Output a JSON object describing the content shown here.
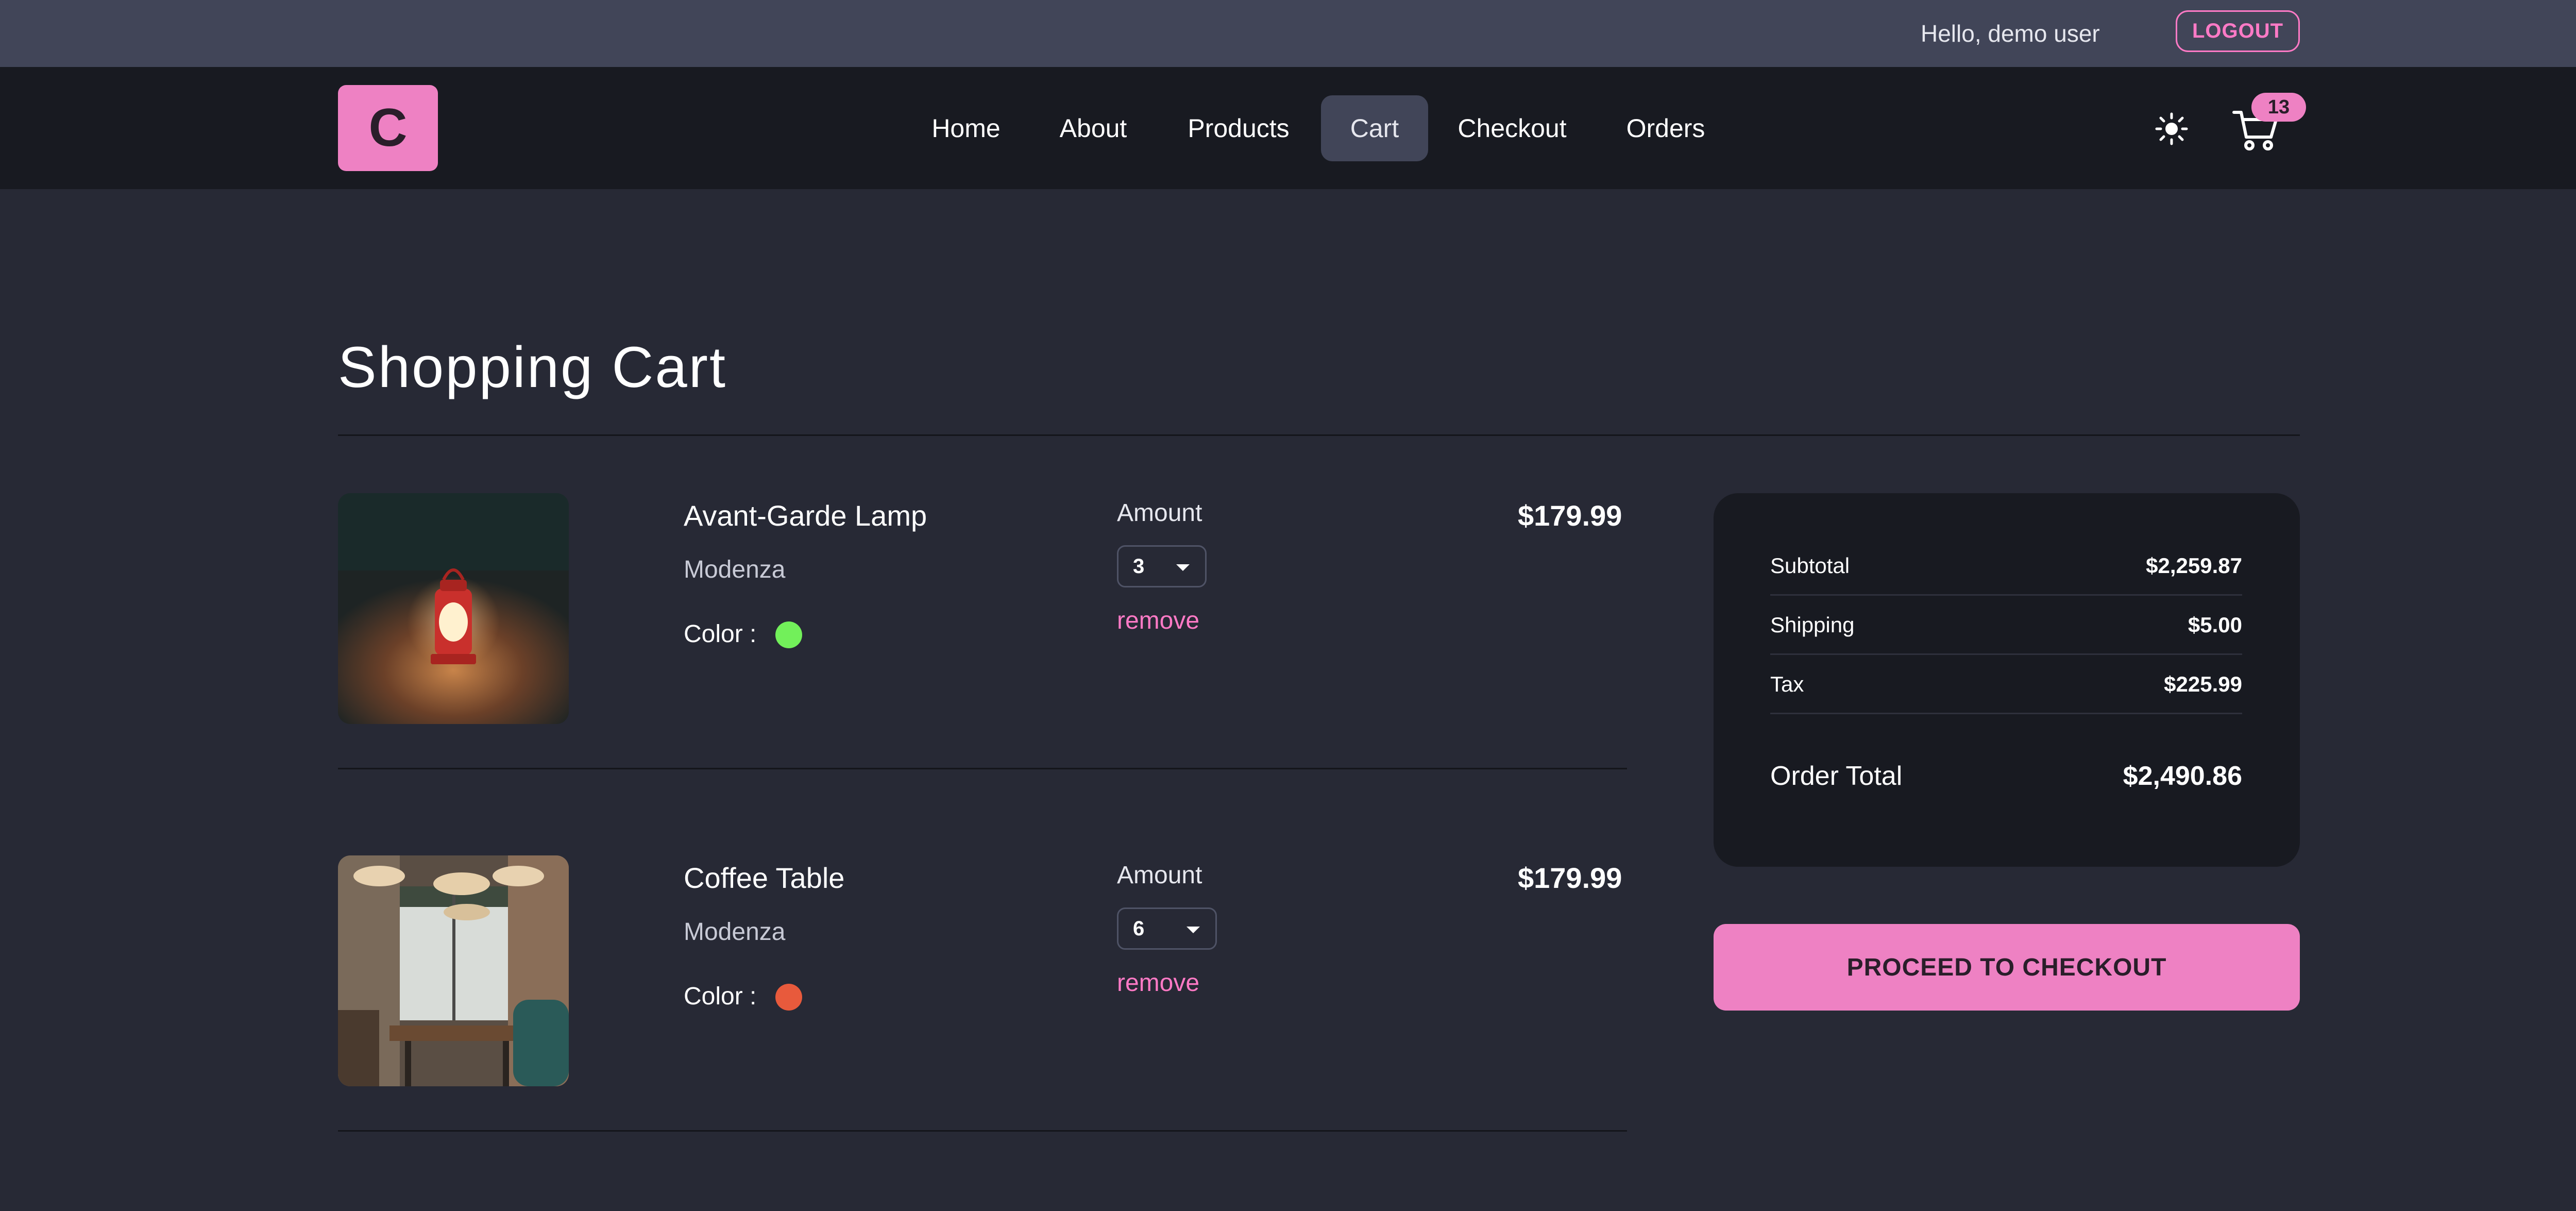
{
  "header": {
    "greeting": "Hello, demo user",
    "logout_label": "LOGOUT"
  },
  "nav": {
    "logo_letter": "C",
    "links": [
      {
        "label": "Home"
      },
      {
        "label": "About"
      },
      {
        "label": "Products"
      },
      {
        "label": "Cart",
        "active": true
      },
      {
        "label": "Checkout"
      },
      {
        "label": "Orders"
      }
    ],
    "theme_icon": "sun-icon",
    "cart_icon": "cart-icon",
    "cart_count": "13"
  },
  "page": {
    "title": "Shopping Cart"
  },
  "cart": {
    "items": [
      {
        "name": "Avant-Garde Lamp",
        "company": "Modenza",
        "color_label": "Color :",
        "color": "#72f05a",
        "amount_label": "Amount",
        "amount": "3",
        "remove_label": "remove",
        "price": "$179.99",
        "image": "lantern-photo"
      },
      {
        "name": "Coffee Table",
        "company": "Modenza",
        "color_label": "Color :",
        "color": "#e85a3c",
        "amount_label": "Amount",
        "amount": "6",
        "remove_label": "remove",
        "price": "$179.99",
        "image": "cafe-interior-photo"
      }
    ]
  },
  "summary": {
    "subtotal_label": "Subtotal",
    "subtotal": "$2,259.87",
    "shipping_label": "Shipping",
    "shipping": "$5.00",
    "tax_label": "Tax",
    "tax": "$225.99",
    "total_label": "Order Total",
    "total": "$2,490.86",
    "checkout_label": "PROCEED TO CHECKOUT"
  },
  "colors": {
    "accent": "#ee81c3",
    "background": "#272935",
    "navbar": "#181a21",
    "topbar": "#414558"
  }
}
